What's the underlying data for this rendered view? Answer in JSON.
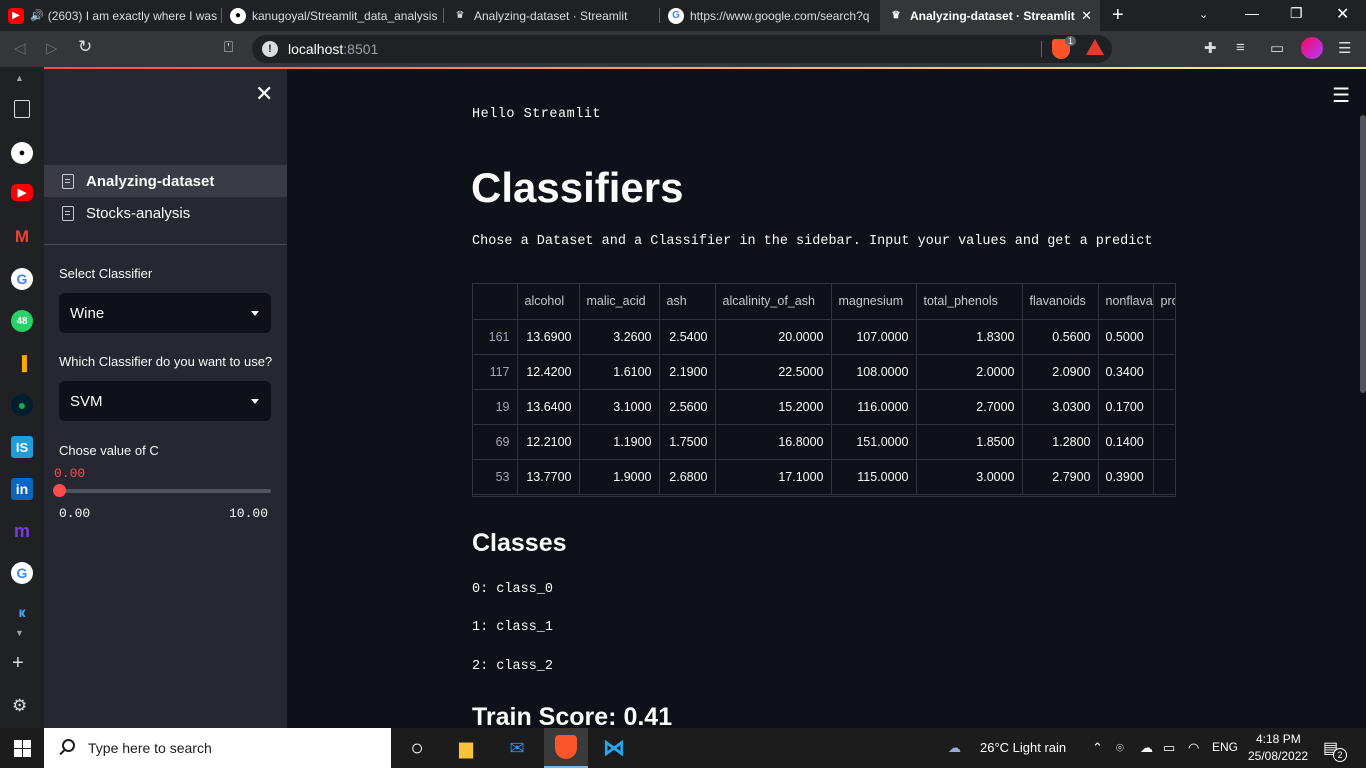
{
  "browser": {
    "tabs": [
      {
        "title": "(2603) I am exactly where I was",
        "favicon": "youtube-icon",
        "active": false
      },
      {
        "title": "kanugoyal/Streamlit_data_analysis",
        "favicon": "github-icon",
        "active": false
      },
      {
        "title": "Analyzing-dataset · Streamlit",
        "favicon": "streamlit-icon",
        "active": false
      },
      {
        "title": "https://www.google.com/search?q",
        "favicon": "google-icon",
        "active": false
      },
      {
        "title": "Analyzing-dataset · Streamlit",
        "favicon": "streamlit-icon",
        "active": true
      }
    ],
    "url_host": "localhost",
    "url_port": ":8501",
    "brave_badge": "1"
  },
  "left_rail": {
    "icons": [
      "bookmark-icon",
      "github-icon",
      "youtube-icon",
      "gmail-icon",
      "google-icon",
      "whatsapp-icon",
      "analytics-icon",
      "mongodb-icon",
      "interviewbit-icon",
      "linkedin-icon",
      "medium-icon",
      "google-icon",
      "kite-icon"
    ],
    "whatsapp_badge": "48",
    "is_label": "IS",
    "in_label": "in"
  },
  "sidebar": {
    "nav": [
      {
        "label": "Analyzing-dataset",
        "active": true
      },
      {
        "label": "Stocks-analysis",
        "active": false
      }
    ],
    "classifier_label": "Select Classifier",
    "classifier_value": "Wine",
    "which_label": "Which Classifier do you want to use?",
    "which_value": "SVM",
    "c_label": "Chose value of C",
    "c_value": "0.00",
    "c_min": "0.00",
    "c_max": "10.00",
    "c_fraction": 0
  },
  "main": {
    "hello": "Hello Streamlit",
    "title": "Classifiers",
    "description": "Chose a Dataset and a Classifier in the sidebar. Input your values and get a predict",
    "table": {
      "columns": [
        "",
        "alcohol",
        "malic_acid",
        "ash",
        "alcalinity_of_ash",
        "magnesium",
        "total_phenols",
        "flavanoids",
        "nonflava",
        "proar"
      ],
      "rows": [
        [
          "161",
          "13.6900",
          "3.2600",
          "2.5400",
          "20.0000",
          "107.0000",
          "1.8300",
          "0.5600",
          "0.5000",
          ""
        ],
        [
          "117",
          "12.4200",
          "1.6100",
          "2.1900",
          "22.5000",
          "108.0000",
          "2.0000",
          "2.0900",
          "0.3400",
          ""
        ],
        [
          "19",
          "13.6400",
          "3.1000",
          "2.5600",
          "15.2000",
          "116.0000",
          "2.7000",
          "3.0300",
          "0.1700",
          ""
        ],
        [
          "69",
          "12.2100",
          "1.1900",
          "1.7500",
          "16.8000",
          "151.0000",
          "1.8500",
          "1.2800",
          "0.1400",
          ""
        ],
        [
          "53",
          "13.7700",
          "1.9000",
          "2.6800",
          "17.1000",
          "115.0000",
          "3.0000",
          "2.7900",
          "0.3900",
          ""
        ]
      ]
    },
    "classes_heading": "Classes",
    "classes": [
      "0: class_0",
      "1: class_1",
      "2: class_2"
    ],
    "train_score": "Train Score: 0.41"
  },
  "taskbar": {
    "search_placeholder": "Type here to search",
    "weather": "26°C  Light rain",
    "lang": "ENG",
    "time": "4:18 PM",
    "date": "25/08/2022",
    "notif_count": "2"
  }
}
